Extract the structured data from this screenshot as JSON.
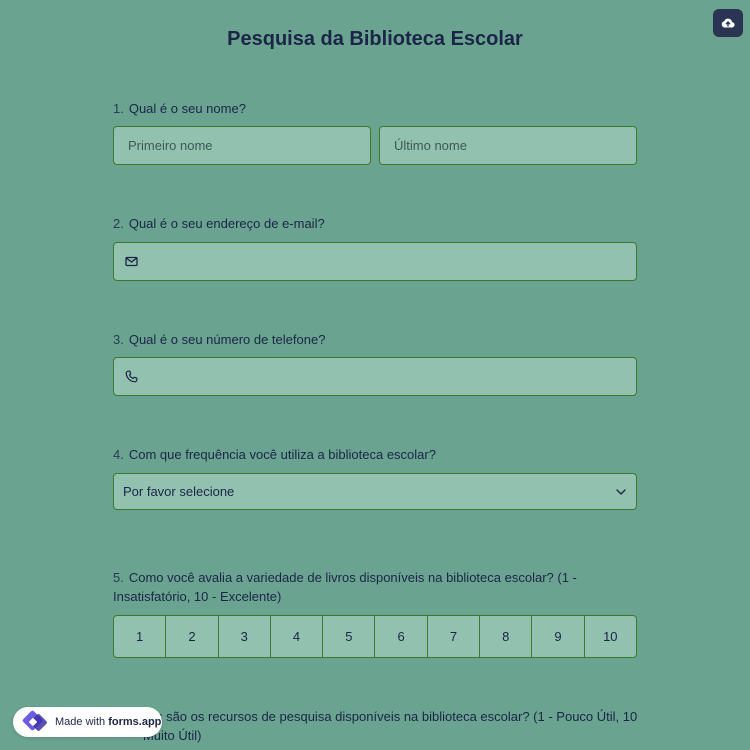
{
  "header": {
    "title": "Pesquisa da Biblioteca Escolar",
    "upload_icon": "cloud-upload-icon"
  },
  "questions": {
    "q1": {
      "number": "1.",
      "label": "Qual é o seu nome?",
      "first_name_placeholder": "Primeiro nome",
      "last_name_placeholder": "Último nome"
    },
    "q2": {
      "number": "2.",
      "label": "Qual é o seu endereço de e-mail?",
      "icon": "envelope-icon"
    },
    "q3": {
      "number": "3.",
      "label": "Qual é o seu número de telefone?",
      "icon": "phone-icon"
    },
    "q4": {
      "number": "4.",
      "label": "Com que frequência você utiliza a biblioteca escolar?",
      "selected": "Por favor selecione"
    },
    "q5": {
      "number": "5.",
      "label": "Como você avalia a variedade de livros disponíveis na biblioteca escolar? (1 - Insatisfatório, 10 - Excelente)",
      "options": [
        "1",
        "2",
        "3",
        "4",
        "5",
        "6",
        "7",
        "8",
        "9",
        "10"
      ]
    },
    "q6": {
      "label": "úteis são os recursos de pesquisa disponíveis na biblioteca escolar? (1 - Pouco Útil, 10 - Muito Útil)"
    }
  },
  "badge": {
    "prefix": "Made with ",
    "brand": "forms.app"
  },
  "colors": {
    "background": "#6aa390",
    "field": "#92c1b0",
    "border": "#3b7a2c",
    "text": "#1b2547",
    "button": "#2b3453"
  }
}
